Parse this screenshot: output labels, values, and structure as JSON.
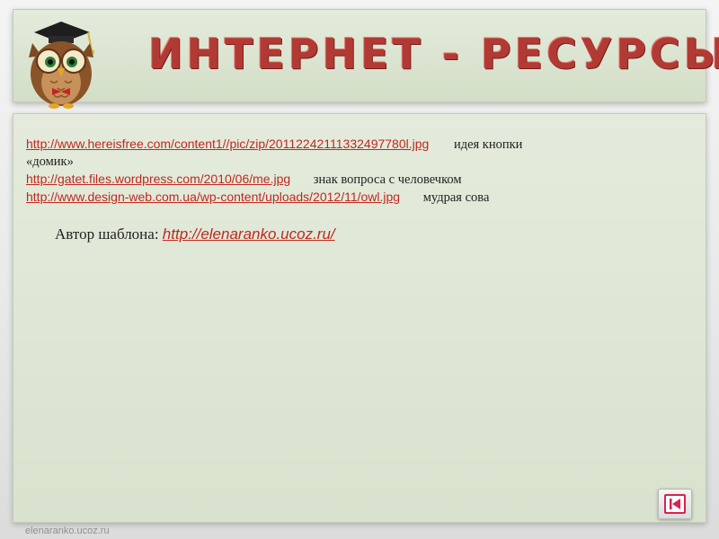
{
  "header": {
    "title": "ИНТЕРНЕТ - РЕСУРСЫ"
  },
  "resources": [
    {
      "url": "http://www.hereisfree.com/content1//pic/zip/20112242111332497780l.jpg",
      "description": "идея кнопки",
      "description_cont": "«домик»"
    },
    {
      "url": "http://gatet.files.wordpress.com/2010/06/me.jpg",
      "description": "знак вопроса с человечком"
    },
    {
      "url": "http://www.design-web.com.ua/wp-content/uploads/2012/11/owl.jpg",
      "description": "мудрая сова"
    }
  ],
  "author": {
    "label": "Автор шаблона: ",
    "url": "http://elenaranko.ucoz.ru/"
  },
  "footer": {
    "site": "elenaranko.ucoz.ru"
  },
  "icons": {
    "logo": "owl-icon",
    "back": "back-arrow-icon"
  },
  "colors": {
    "link": "#c0281e",
    "title": "#b23a34",
    "panel": "#dbe4d1"
  }
}
